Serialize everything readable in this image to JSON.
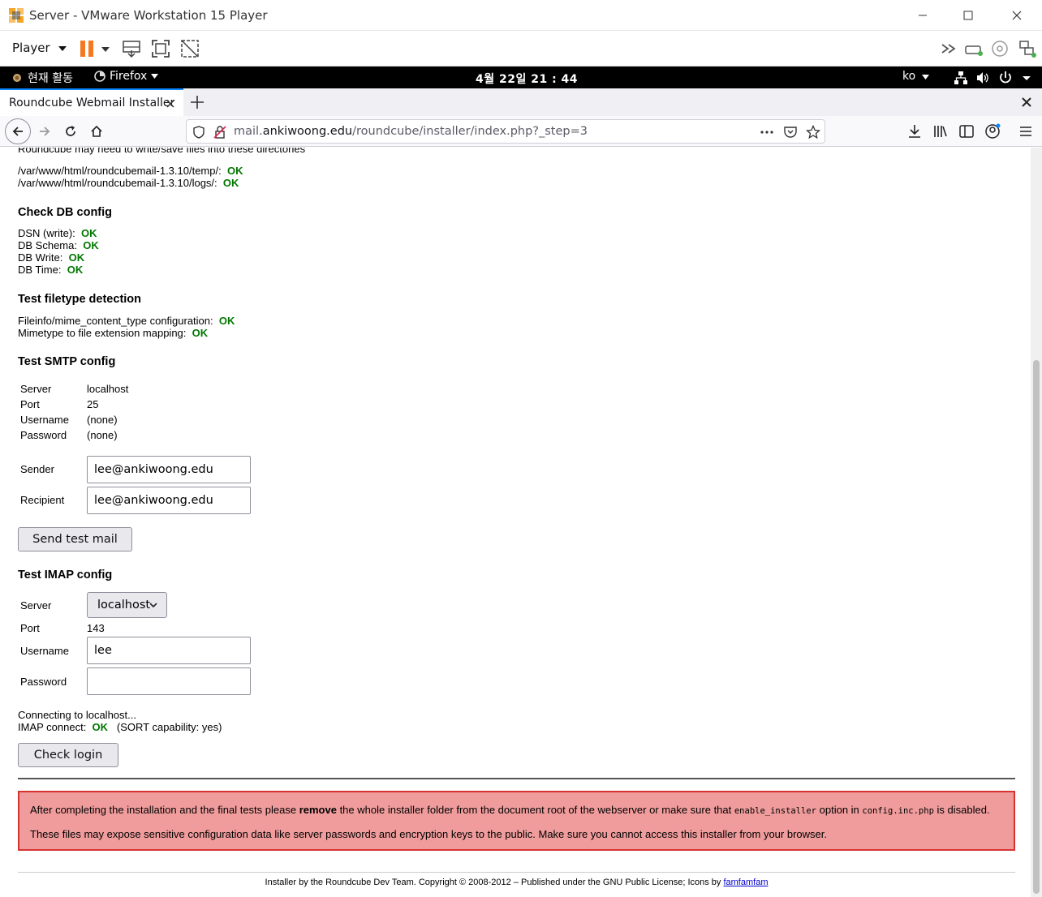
{
  "vmware": {
    "title": "Server - VMware Workstation 15 Player",
    "player_menu": "Player"
  },
  "gnome": {
    "activities": "현재 활동",
    "app_menu": "Firefox",
    "clock": "4월 22일  21 : 44",
    "lang": "ko"
  },
  "firefox": {
    "tab_title": "Roundcube Webmail Installer",
    "url_prefix": "mail.",
    "url_host": "ankiwoong.edu",
    "url_path": "/roundcube/installer/index.php?_step=3",
    "accent": "#0a84ff"
  },
  "page": {
    "cut_line": "Roundcube may need to write/save files into these directories",
    "dirs": [
      {
        "path": "/var/www/html/roundcubemail-1.3.10/temp/:",
        "status": "OK"
      },
      {
        "path": "/var/www/html/roundcubemail-1.3.10/logs/:",
        "status": "OK"
      }
    ],
    "db": {
      "heading": "Check DB config",
      "items": [
        {
          "label": "DSN (write):",
          "status": "OK"
        },
        {
          "label": "DB Schema:",
          "status": "OK"
        },
        {
          "label": "DB Write:",
          "status": "OK"
        },
        {
          "label": "DB Time:",
          "status": "OK"
        }
      ]
    },
    "filetype": {
      "heading": "Test filetype detection",
      "items": [
        {
          "label": "Fileinfo/mime_content_type configuration:",
          "status": "OK"
        },
        {
          "label": "Mimetype to file extension mapping:",
          "status": "OK"
        }
      ]
    },
    "smtp": {
      "heading": "Test SMTP config",
      "rows": [
        {
          "label": "Server",
          "value": "localhost"
        },
        {
          "label": "Port",
          "value": "25"
        },
        {
          "label": "Username",
          "value": "(none)"
        },
        {
          "label": "Password",
          "value": "(none)"
        }
      ],
      "sender_label": "Sender",
      "sender_value": "lee@ankiwoong.edu",
      "recipient_label": "Recipient",
      "recipient_value": "lee@ankiwoong.edu",
      "button": "Send test mail"
    },
    "imap": {
      "heading": "Test IMAP config",
      "server_label": "Server",
      "server_value": "localhost",
      "port_label": "Port",
      "port_value": "143",
      "username_label": "Username",
      "username_value": "lee",
      "password_label": "Password",
      "password_value": "",
      "connecting": "Connecting to localhost...",
      "connect_label": "IMAP connect:",
      "connect_status": "OK",
      "sort_cap": "(SORT capability: yes)",
      "button": "Check login"
    },
    "warning": {
      "part1": "After completing the installation and the final tests please ",
      "part2": "remove",
      "part3": " the whole installer folder from the document root of the webserver or make sure that ",
      "code1": "enable_installer",
      "part4": " option in ",
      "code2": "config.inc.php",
      "part5": " is disabled.",
      "line2": "These files may expose sensitive configuration data like server passwords and encryption keys to the public. Make sure you cannot access this installer from your browser."
    },
    "footer": {
      "text": "Installer by the Roundcube Dev Team. Copyright © 2008-2012 – Published under the GNU Public License;  Icons by ",
      "link": "famfamfam"
    }
  }
}
